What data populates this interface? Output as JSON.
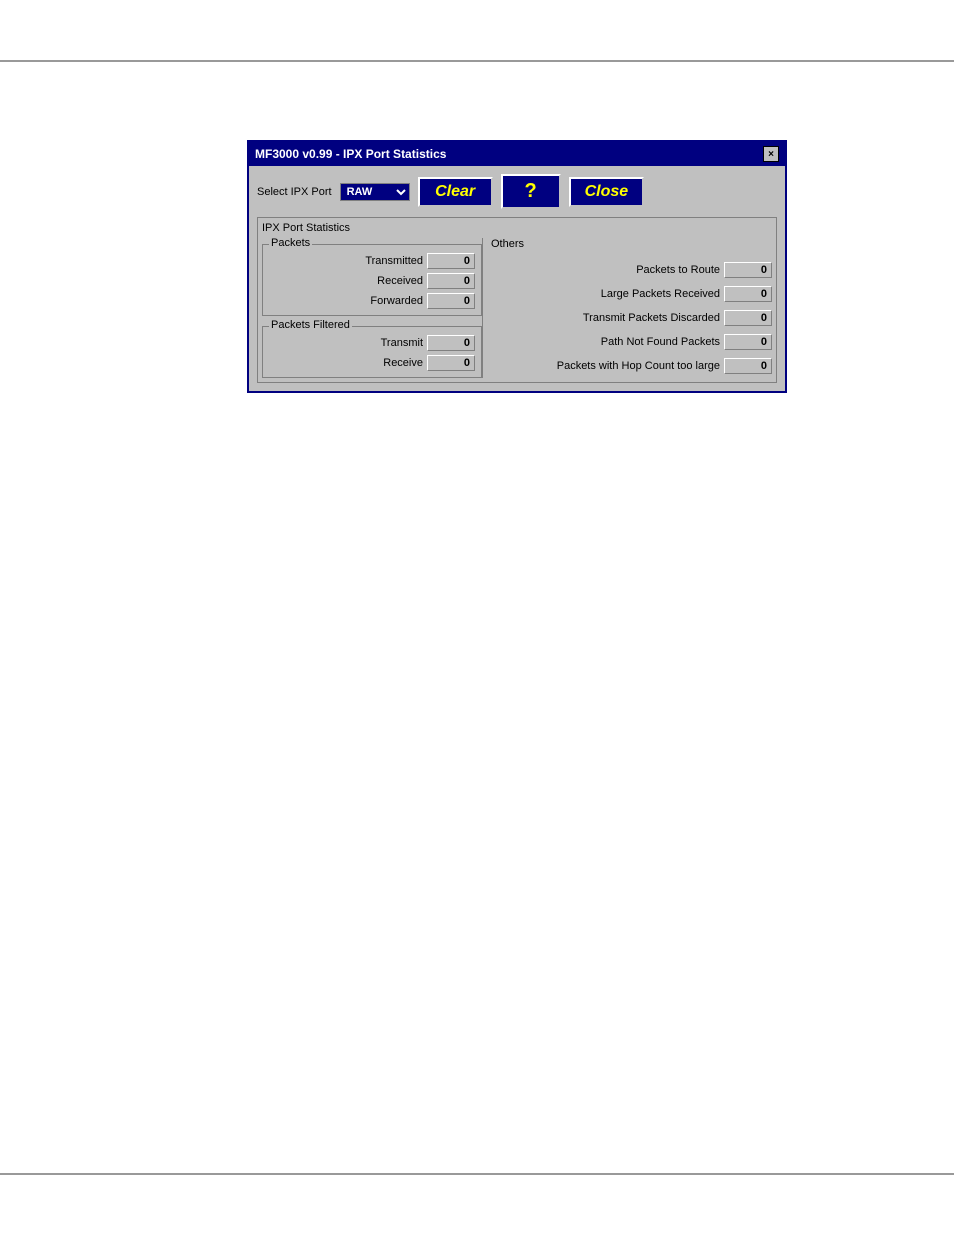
{
  "dialog": {
    "title": "MF3000 v0.99 - IPX Port Statistics",
    "close_x": "×",
    "select_label": "Select IPX Port",
    "port_value": "RAW",
    "buttons": {
      "clear": "Clear",
      "help": "?",
      "close": "Close"
    },
    "stats_outer_label": "IPX Port Statistics",
    "packets_group_label": "Packets",
    "packets": {
      "transmitted_label": "Transmitted",
      "transmitted_value": "0",
      "received_label": "Received",
      "received_value": "0",
      "forwarded_label": "Forwarded",
      "forwarded_value": "0"
    },
    "packets_filtered_label": "Packets Filtered",
    "packets_filtered": {
      "transmit_label": "Transmit",
      "transmit_value": "0",
      "receive_label": "Receive",
      "receive_value": "0"
    },
    "others_label": "Others",
    "others": {
      "packets_to_route_label": "Packets to Route",
      "packets_to_route_value": "0",
      "large_packets_label": "Large Packets Received",
      "large_packets_value": "0",
      "transmit_discarded_label": "Transmit Packets Discarded",
      "transmit_discarded_value": "0",
      "path_not_found_label": "Path Not Found Packets",
      "path_not_found_value": "0",
      "hop_count_label": "Packets with Hop Count too large",
      "hop_count_value": "0"
    }
  }
}
